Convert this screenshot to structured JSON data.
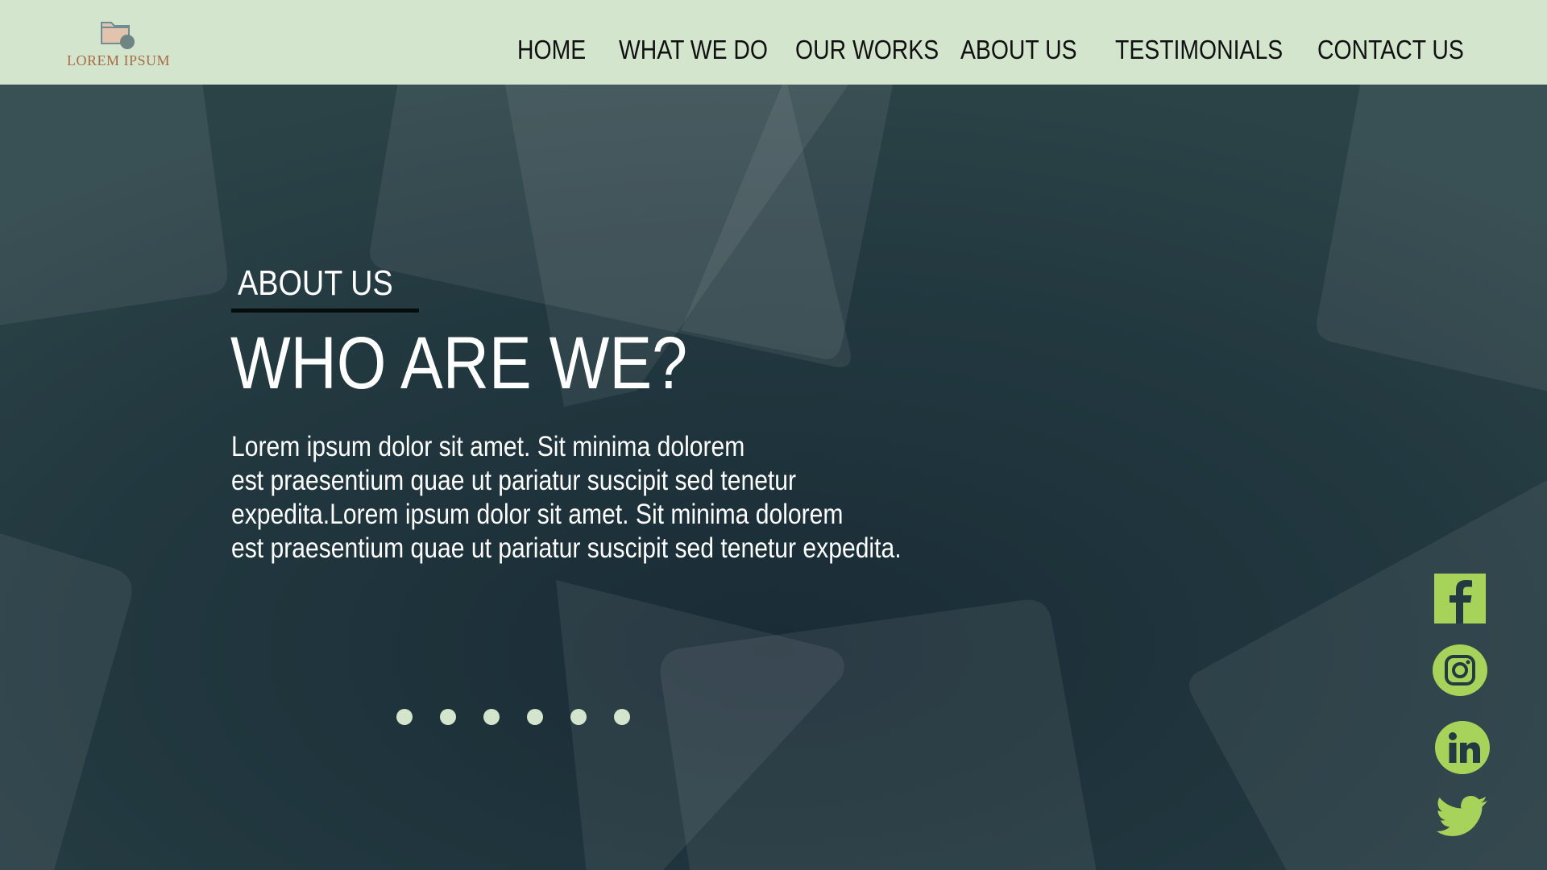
{
  "header": {
    "logo_text": "LOREM IPSUM",
    "nav": [
      {
        "label": "HOME"
      },
      {
        "label": "WHAT WE DO"
      },
      {
        "label": "OUR WORKS"
      },
      {
        "label": "ABOUT US"
      },
      {
        "label": "TESTIMONIALS"
      },
      {
        "label": "CONTACT US"
      }
    ]
  },
  "hero": {
    "eyebrow": "ABOUT US",
    "title": "WHO ARE WE?",
    "body_lines": [
      "Lorem ipsum dolor sit amet. Sit minima dolorem",
      "est praesentium quae ut pariatur suscipit sed tenetur",
      "expedita.Lorem ipsum dolor sit amet. Sit minima dolorem",
      "est praesentium quae ut pariatur suscipit sed tenetur expedita."
    ],
    "slide_count": 6
  },
  "social": [
    {
      "icon": "facebook-icon"
    },
    {
      "icon": "instagram-icon"
    },
    {
      "icon": "linkedin-icon"
    },
    {
      "icon": "twitter-icon"
    }
  ],
  "colors": {
    "header_bg": "#d3e5cd",
    "hero_bg": "#243a42",
    "text": "#ffffff",
    "accent_green": "#a8d35a",
    "logo_text": "#a86b45",
    "dot": "#d3e5cd"
  }
}
